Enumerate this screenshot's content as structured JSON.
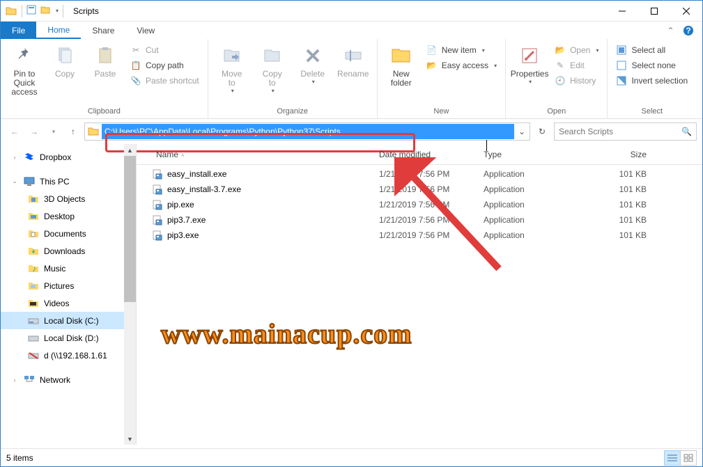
{
  "window": {
    "title": "Scripts"
  },
  "tabs": {
    "file": "File",
    "home": "Home",
    "share": "Share",
    "view": "View"
  },
  "ribbon": {
    "clipboard": {
      "label": "Clipboard",
      "pin": "Pin to Quick\naccess",
      "copy": "Copy",
      "paste": "Paste",
      "cut": "Cut",
      "copy_path": "Copy path",
      "paste_shortcut": "Paste shortcut"
    },
    "organize": {
      "label": "Organize",
      "move_to": "Move\nto",
      "copy_to": "Copy\nto",
      "delete": "Delete",
      "rename": "Rename"
    },
    "new": {
      "label": "New",
      "new_folder": "New\nfolder",
      "new_item": "New item",
      "easy_access": "Easy access"
    },
    "open": {
      "label": "Open",
      "properties": "Properties",
      "open": "Open",
      "edit": "Edit",
      "history": "History"
    },
    "select": {
      "label": "Select",
      "select_all": "Select all",
      "select_none": "Select none",
      "invert": "Invert selection"
    }
  },
  "address": {
    "path": "C:\\Users\\PC\\AppData\\Local\\Programs\\Python\\Python37\\Scripts"
  },
  "search": {
    "placeholder": "Search Scripts"
  },
  "columns": {
    "name": "Name",
    "date": "Date modified",
    "type": "Type",
    "size": "Size"
  },
  "nav": {
    "dropbox": "Dropbox",
    "this_pc": "This PC",
    "three_d": "3D Objects",
    "desktop": "Desktop",
    "documents": "Documents",
    "downloads": "Downloads",
    "music": "Music",
    "pictures": "Pictures",
    "videos": "Videos",
    "local_c": "Local Disk (C:)",
    "local_d": "Local Disk (D:)",
    "net_d": "d (\\\\192.168.1.61",
    "network": "Network"
  },
  "files": [
    {
      "name": "easy_install.exe",
      "date": "1/21/2019 7:56 PM",
      "type": "Application",
      "size": "101 KB"
    },
    {
      "name": "easy_install-3.7.exe",
      "date": "1/21/2019 7:56 PM",
      "type": "Application",
      "size": "101 KB"
    },
    {
      "name": "pip.exe",
      "date": "1/21/2019 7:56 PM",
      "type": "Application",
      "size": "101 KB"
    },
    {
      "name": "pip3.7.exe",
      "date": "1/21/2019 7:56 PM",
      "type": "Application",
      "size": "101 KB"
    },
    {
      "name": "pip3.exe",
      "date": "1/21/2019 7:56 PM",
      "type": "Application",
      "size": "101 KB"
    }
  ],
  "status": {
    "items": "5 items"
  },
  "watermark": "www.mainacup.com"
}
